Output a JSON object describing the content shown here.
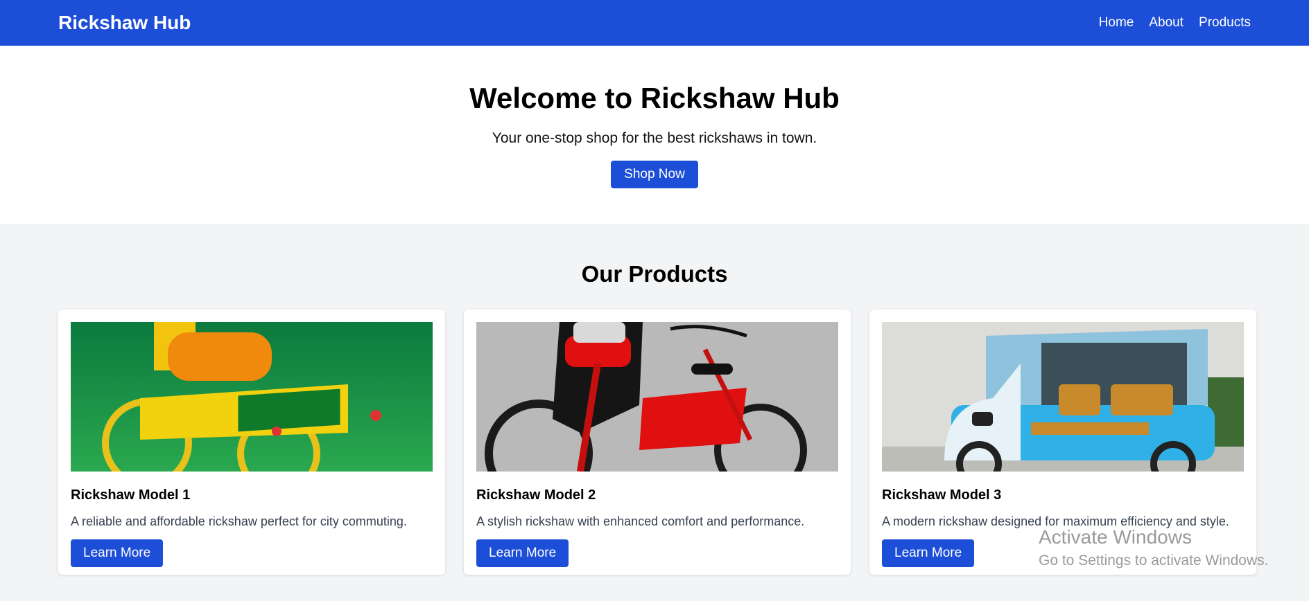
{
  "navbar": {
    "brand": "Rickshaw Hub",
    "links": [
      "Home",
      "About",
      "Products"
    ]
  },
  "hero": {
    "title": "Welcome to Rickshaw Hub",
    "subtitle": "Your one-stop shop for the best rickshaws in town.",
    "button": "Shop Now"
  },
  "products": {
    "heading": "Our Products",
    "items": [
      {
        "title": "Rickshaw Model 1",
        "description": "A reliable and affordable rickshaw perfect for city commuting.",
        "button": "Learn More"
      },
      {
        "title": "Rickshaw Model 2",
        "description": "A stylish rickshaw with enhanced comfort and performance.",
        "button": "Learn More"
      },
      {
        "title": "Rickshaw Model 3",
        "description": "A modern rickshaw designed for maximum efficiency and style.",
        "button": "Learn More"
      }
    ]
  },
  "watermark": {
    "line1": "Activate Windows",
    "line2": "Go to Settings to activate Windows."
  },
  "colors": {
    "primary": "#1d4ed8",
    "background": "#f3f4f6"
  }
}
